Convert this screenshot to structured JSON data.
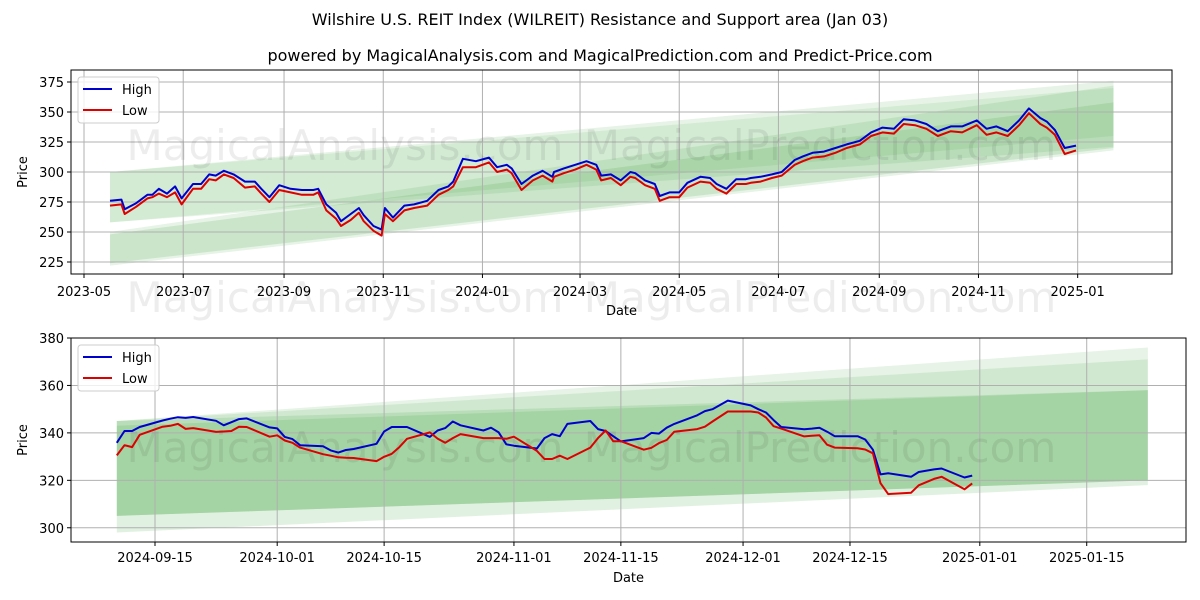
{
  "title": "Wilshire U.S. REIT Index (WILREIT) Resistance and Support area (Jan 03)",
  "subtitle": "powered by MagicalAnalysis.com and MagicalPrediction.com and Predict-Price.com",
  "watermarks": [
    "MagicalAnalysis.com",
    "MagicalPrediction.com"
  ],
  "colors": {
    "high": "#0000cc",
    "low": "#dd0000",
    "band": "#2e9a2e",
    "grid": "#b0b0b0"
  },
  "chart_data": [
    {
      "type": "line",
      "title": "",
      "xlabel": "Date",
      "ylabel": "Price",
      "ylim": [
        215,
        385
      ],
      "xlim": [
        "2023-04-23",
        "2025-02-28"
      ],
      "yticks": [
        225,
        250,
        275,
        300,
        325,
        350,
        375
      ],
      "xticks": [
        "2023-05",
        "2023-07",
        "2023-09",
        "2023-11",
        "2024-01",
        "2024-03",
        "2024-05",
        "2024-07",
        "2024-09",
        "2024-11",
        "2025-01"
      ],
      "grid": true,
      "legend": {
        "placement": "top-left",
        "entries": [
          "High",
          "Low"
        ]
      },
      "bands": [
        {
          "name": "resistance-outer",
          "x": [
            "2023-05-17",
            "2025-01-23"
          ],
          "upper": [
            300,
            376
          ],
          "lower": [
            258,
            321
          ],
          "opacity": 0.12
        },
        {
          "name": "resistance-inner",
          "x": [
            "2023-05-17",
            "2025-01-23"
          ],
          "upper": [
            300,
            370
          ],
          "lower": [
            258,
            330
          ],
          "opacity": 0.1
        },
        {
          "name": "support-outer",
          "x": [
            "2023-05-17",
            "2025-01-23"
          ],
          "upper": [
            250,
            372
          ],
          "lower": [
            222,
            318
          ],
          "opacity": 0.12
        },
        {
          "name": "support-inner",
          "x": [
            "2023-05-17",
            "2025-01-23"
          ],
          "upper": [
            248,
            358
          ],
          "lower": [
            224,
            320
          ],
          "opacity": 0.15
        }
      ],
      "x": [
        "2023-05-17",
        "2023-05-24",
        "2023-05-26",
        "2023-06-02",
        "2023-06-09",
        "2023-06-12",
        "2023-06-16",
        "2023-06-21",
        "2023-06-26",
        "2023-06-30",
        "2023-07-07",
        "2023-07-12",
        "2023-07-17",
        "2023-07-21",
        "2023-07-26",
        "2023-08-01",
        "2023-08-08",
        "2023-08-14",
        "2023-08-18",
        "2023-08-23",
        "2023-08-29",
        "2023-09-05",
        "2023-09-12",
        "2023-09-19",
        "2023-09-22",
        "2023-09-27",
        "2023-10-03",
        "2023-10-06",
        "2023-10-12",
        "2023-10-17",
        "2023-10-20",
        "2023-10-26",
        "2023-10-31",
        "2023-11-02",
        "2023-11-07",
        "2023-11-14",
        "2023-11-20",
        "2023-11-28",
        "2023-12-05",
        "2023-12-11",
        "2023-12-14",
        "2023-12-20",
        "2023-12-28",
        "2024-01-05",
        "2024-01-10",
        "2024-01-16",
        "2024-01-19",
        "2024-01-25",
        "2024-02-01",
        "2024-02-07",
        "2024-02-13",
        "2024-02-14",
        "2024-02-20",
        "2024-02-27",
        "2024-03-05",
        "2024-03-11",
        "2024-03-14",
        "2024-03-20",
        "2024-03-26",
        "2024-04-01",
        "2024-04-04",
        "2024-04-10",
        "2024-04-16",
        "2024-04-19",
        "2024-04-25",
        "2024-05-01",
        "2024-05-06",
        "2024-05-14",
        "2024-05-20",
        "2024-05-24",
        "2024-05-30",
        "2024-06-05",
        "2024-06-11",
        "2024-06-14",
        "2024-06-20",
        "2024-06-27",
        "2024-07-03",
        "2024-07-11",
        "2024-07-16",
        "2024-07-22",
        "2024-07-29",
        "2024-08-05",
        "2024-08-12",
        "2024-08-20",
        "2024-08-27",
        "2024-09-03",
        "2024-09-10",
        "2024-09-16",
        "2024-09-23",
        "2024-09-30",
        "2024-10-07",
        "2024-10-15",
        "2024-10-22",
        "2024-10-31",
        "2024-11-06",
        "2024-11-12",
        "2024-11-19",
        "2024-11-26",
        "2024-12-02",
        "2024-12-09",
        "2024-12-13",
        "2024-12-18",
        "2024-12-24",
        "2024-12-31"
      ],
      "series": [
        {
          "name": "High",
          "values": [
            276,
            277,
            269,
            274,
            281,
            281,
            286,
            282,
            288,
            278,
            290,
            290,
            298,
            297,
            301,
            298,
            292,
            292,
            286,
            279,
            289,
            286,
            285,
            285,
            286,
            273,
            266,
            259,
            265,
            270,
            264,
            255,
            252,
            270,
            262,
            272,
            273,
            276,
            285,
            288,
            292,
            311,
            309,
            312,
            304,
            306,
            303,
            290,
            297,
            301,
            296,
            300,
            303,
            306,
            309,
            306,
            297,
            298,
            293,
            300,
            299,
            293,
            290,
            280,
            283,
            283,
            291,
            296,
            295,
            290,
            286,
            294,
            294,
            295,
            296,
            298,
            300,
            310,
            313,
            316,
            317,
            320,
            323,
            326,
            333,
            337,
            336,
            344,
            343,
            340,
            334,
            338,
            338,
            343,
            336,
            338,
            334,
            343,
            353,
            345,
            342,
            335,
            320,
            322
          ]
        },
        {
          "name": "Low",
          "values": [
            272,
            273,
            265,
            271,
            278,
            279,
            282,
            279,
            283,
            273,
            286,
            286,
            294,
            293,
            298,
            295,
            287,
            288,
            282,
            275,
            285,
            283,
            281,
            281,
            283,
            268,
            261,
            255,
            260,
            266,
            259,
            251,
            247,
            265,
            259,
            268,
            270,
            272,
            281,
            285,
            288,
            304,
            304,
            308,
            300,
            302,
            299,
            285,
            293,
            297,
            292,
            296,
            299,
            302,
            306,
            302,
            293,
            295,
            289,
            296,
            295,
            289,
            286,
            276,
            279,
            279,
            287,
            292,
            291,
            286,
            282,
            290,
            290,
            291,
            292,
            295,
            297,
            306,
            309,
            312,
            313,
            316,
            320,
            323,
            330,
            333,
            332,
            340,
            339,
            336,
            330,
            334,
            333,
            339,
            331,
            333,
            330,
            339,
            349,
            340,
            337,
            331,
            315,
            318
          ]
        }
      ]
    },
    {
      "type": "line",
      "title": "",
      "xlabel": "Date",
      "ylabel": "Price",
      "ylim": [
        294,
        380
      ],
      "xlim": [
        "2024-09-04",
        "2025-01-28"
      ],
      "yticks": [
        300,
        320,
        340,
        360,
        380
      ],
      "xticks": [
        "2024-09-15",
        "2024-10-01",
        "2024-10-15",
        "2024-11-01",
        "2024-11-15",
        "2024-12-01",
        "2024-12-15",
        "2025-01-01",
        "2025-01-15"
      ],
      "grid": true,
      "legend": {
        "placement": "top-left",
        "entries": [
          "High",
          "Low"
        ]
      },
      "bands": [
        {
          "name": "resistance-outer",
          "x": [
            "2024-09-10",
            "2025-01-23"
          ],
          "upper": [
            345,
            376
          ],
          "lower": [
            305,
            320
          ],
          "opacity": 0.12
        },
        {
          "name": "resistance-inner",
          "x": [
            "2024-09-10",
            "2025-01-23"
          ],
          "upper": [
            345,
            371
          ],
          "lower": [
            305,
            320
          ],
          "opacity": 0.12
        },
        {
          "name": "support-outer",
          "x": [
            "2024-09-10",
            "2025-01-23"
          ],
          "upper": [
            345,
            358
          ],
          "lower": [
            298,
            318
          ],
          "opacity": 0.14
        },
        {
          "name": "support-inner",
          "x": [
            "2024-09-10",
            "2025-01-23"
          ],
          "upper": [
            343,
            358
          ],
          "lower": [
            305,
            320
          ],
          "opacity": 0.14
        }
      ],
      "x": [
        "2024-09-10",
        "2024-09-11",
        "2024-09-12",
        "2024-09-13",
        "2024-09-16",
        "2024-09-17",
        "2024-09-18",
        "2024-09-19",
        "2024-09-20",
        "2024-09-23",
        "2024-09-24",
        "2024-09-25",
        "2024-09-26",
        "2024-09-27",
        "2024-09-30",
        "2024-10-01",
        "2024-10-02",
        "2024-10-03",
        "2024-10-04",
        "2024-10-07",
        "2024-10-08",
        "2024-10-09",
        "2024-10-10",
        "2024-10-11",
        "2024-10-14",
        "2024-10-15",
        "2024-10-16",
        "2024-10-17",
        "2024-10-18",
        "2024-10-21",
        "2024-10-22",
        "2024-10-23",
        "2024-10-24",
        "2024-10-25",
        "2024-10-28",
        "2024-10-29",
        "2024-10-30",
        "2024-10-31",
        "2024-11-01",
        "2024-11-04",
        "2024-11-05",
        "2024-11-06",
        "2024-11-07",
        "2024-11-08",
        "2024-11-11",
        "2024-11-12",
        "2024-11-13",
        "2024-11-14",
        "2024-11-15",
        "2024-11-18",
        "2024-11-19",
        "2024-11-20",
        "2024-11-21",
        "2024-11-22",
        "2024-11-25",
        "2024-11-26",
        "2024-11-27",
        "2024-11-29",
        "2024-12-02",
        "2024-12-03",
        "2024-12-04",
        "2024-12-05",
        "2024-12-06",
        "2024-12-09",
        "2024-12-10",
        "2024-12-11",
        "2024-12-12",
        "2024-12-13",
        "2024-12-16",
        "2024-12-17",
        "2024-12-18",
        "2024-12-19",
        "2024-12-20",
        "2024-12-23",
        "2024-12-24",
        "2024-12-26",
        "2024-12-27",
        "2024-12-30",
        "2024-12-31"
      ],
      "series": [
        {
          "name": "High",
          "values": [
            335.8,
            340.8,
            340.8,
            342.5,
            345.2,
            346.0,
            346.6,
            346.3,
            346.7,
            345.1,
            343.2,
            344.5,
            345.8,
            346.1,
            342.3,
            341.9,
            338.3,
            337.4,
            334.8,
            334.4,
            332.6,
            331.7,
            332.8,
            333.2,
            335.4,
            340.6,
            342.5,
            342.5,
            342.5,
            338.3,
            341.0,
            342.0,
            344.8,
            343.2,
            341.0,
            342.2,
            340.2,
            335.2,
            334.6,
            333.4,
            337.8,
            339.5,
            338.6,
            343.8,
            345.0,
            341.6,
            340.8,
            338.6,
            336.4,
            337.8,
            340.0,
            339.7,
            342.2,
            343.8,
            347.4,
            349.2,
            350.0,
            353.6,
            351.6,
            350.0,
            348.6,
            345.4,
            342.5,
            341.5,
            341.8,
            342.2,
            340.5,
            338.6,
            338.6,
            337.2,
            332.9,
            322.5,
            323.0,
            321.5,
            323.5,
            324.6,
            325.0,
            321.2,
            322.0
          ]
        },
        {
          "name": "Low",
          "values": [
            330.5,
            334.8,
            334.0,
            339.2,
            342.6,
            343.0,
            343.8,
            341.7,
            342.0,
            340.4,
            340.6,
            340.8,
            342.6,
            342.5,
            338.4,
            339.0,
            336.8,
            335.8,
            333.8,
            331.0,
            330.4,
            329.7,
            329.5,
            329.4,
            328.1,
            329.9,
            331.2,
            334.0,
            337.5,
            340.2,
            337.6,
            335.8,
            337.8,
            339.5,
            337.8,
            337.8,
            337.8,
            337.5,
            338.4,
            332.4,
            329.0,
            329.0,
            330.4,
            329.0,
            333.8,
            337.8,
            341.0,
            336.5,
            336.5,
            332.9,
            333.7,
            335.7,
            337.0,
            340.5,
            341.6,
            342.6,
            344.8,
            349.0,
            349.0,
            348.6,
            346.5,
            342.8,
            341.8,
            338.5,
            338.8,
            339.0,
            335.0,
            333.8,
            333.5,
            333.0,
            331.4,
            318.8,
            314.2,
            314.8,
            317.9,
            320.6,
            321.5,
            316.2,
            318.7
          ]
        }
      ]
    }
  ]
}
